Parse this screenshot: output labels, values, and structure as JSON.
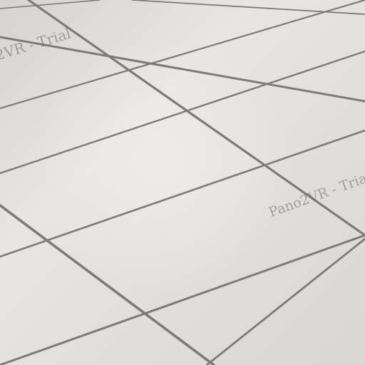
{
  "scene": {
    "subject": "ceramic-tile-floor-panorama",
    "tile_color": "#e3e0dd",
    "grout_color": "#7d7a78"
  },
  "watermarks": [
    {
      "text": "2VR - Trial"
    },
    {
      "text": "Pano2VR - Trial"
    }
  ]
}
